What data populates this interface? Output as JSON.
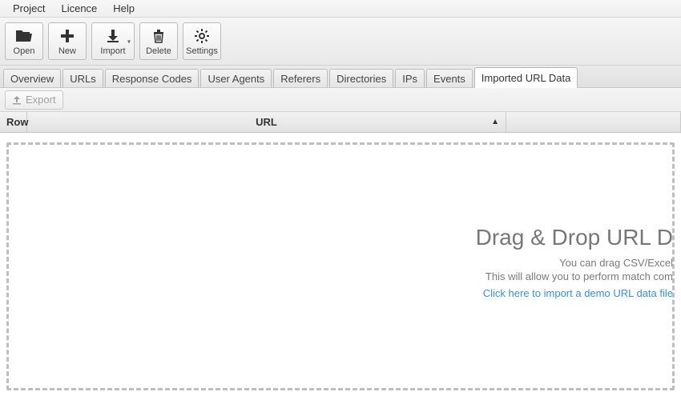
{
  "menubar": {
    "project": "Project",
    "licence": "Licence",
    "help": "Help"
  },
  "toolbar": {
    "open": "Open",
    "new": "New",
    "import": "Import",
    "delete": "Delete",
    "settings": "Settings"
  },
  "tabs": {
    "overview": "Overview",
    "urls": "URLs",
    "response_codes": "Response Codes",
    "user_agents": "User Agents",
    "referers": "Referers",
    "directories": "Directories",
    "ips": "IPs",
    "events": "Events",
    "imported_url_data": "Imported URL Data"
  },
  "exportbar": {
    "export": "Export"
  },
  "columns": {
    "row": "Row",
    "url": "URL"
  },
  "dropzone": {
    "title": "Drag & Drop URL D",
    "sub1": "You can drag CSV/Excel",
    "sub2": "This will allow you to perform match com",
    "link": "Click here to import a demo URL data file"
  }
}
